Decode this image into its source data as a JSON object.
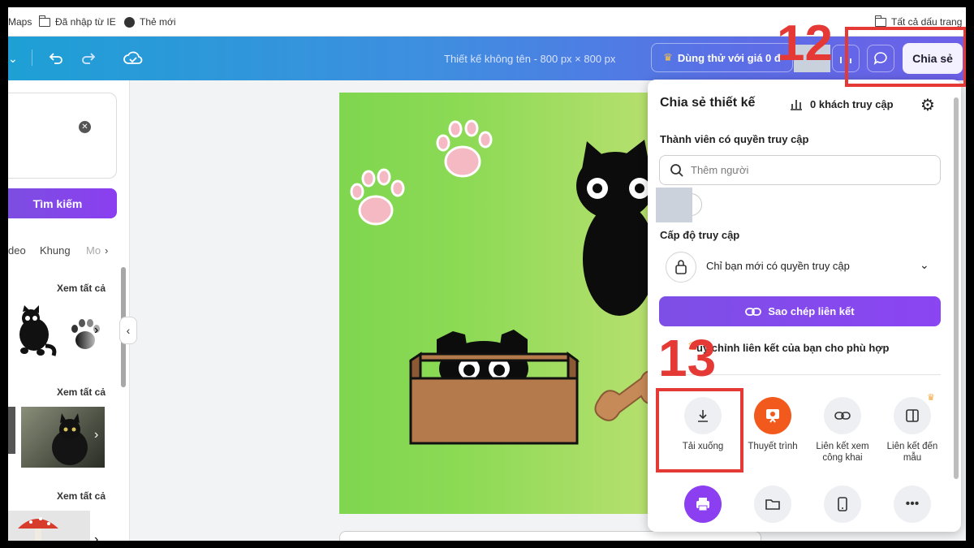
{
  "bookmarks": {
    "maps": "Maps",
    "imported_ie": "Đã nhập từ IE",
    "new_tab": "Thẻ mới",
    "all_bookmarks": "Tất cả dấu trang"
  },
  "toolbar": {
    "doc_title": "Thiết kế không tên - 800 px × 800 px",
    "trial_label": "Dùng thử với giá 0 đ",
    "share_label": "Chia sẻ",
    "icons": [
      "chevron-down-icon",
      "undo-icon",
      "redo-icon",
      "cloud-saved-icon",
      "crown-icon",
      "stats-icon",
      "comment-icon"
    ]
  },
  "left_panel": {
    "search_button": "Tìm kiếm",
    "tabs": [
      "deo",
      "Khung",
      "Mo"
    ],
    "see_all": "Xem tất cả"
  },
  "share_panel": {
    "title": "Chia sẻ thiết kế",
    "visitors": "0 khách truy cập",
    "members_label": "Thành viên có quyền truy cập",
    "add_people_placeholder": "Thêm người",
    "access_level_label": "Cấp độ truy cập",
    "access_value": "Chỉ bạn mới có quyền truy cập",
    "copy_link": "Sao chép liên kết",
    "customize_link": "uy chỉnh liên kết của bạn cho phù hợp",
    "options": [
      {
        "label": "Tải xuống",
        "icon": "download-icon"
      },
      {
        "label": "Thuyết trình",
        "icon": "present-icon"
      },
      {
        "label": "Liên kết xem công khai",
        "icon": "link-icon"
      },
      {
        "label": "Liên kết đến mẫu",
        "icon": "template-icon"
      }
    ],
    "row2_icons": [
      "printer-icon",
      "folder-icon",
      "mobile-icon",
      "more-icon"
    ]
  },
  "annotations": {
    "step12": "12",
    "step13": "13",
    "highlight_color": "#e53935"
  },
  "colors": {
    "accent_purple": "#8b3ff0",
    "toolbar_start": "#1ea0d5",
    "toolbar_end": "#6d5fe8"
  }
}
